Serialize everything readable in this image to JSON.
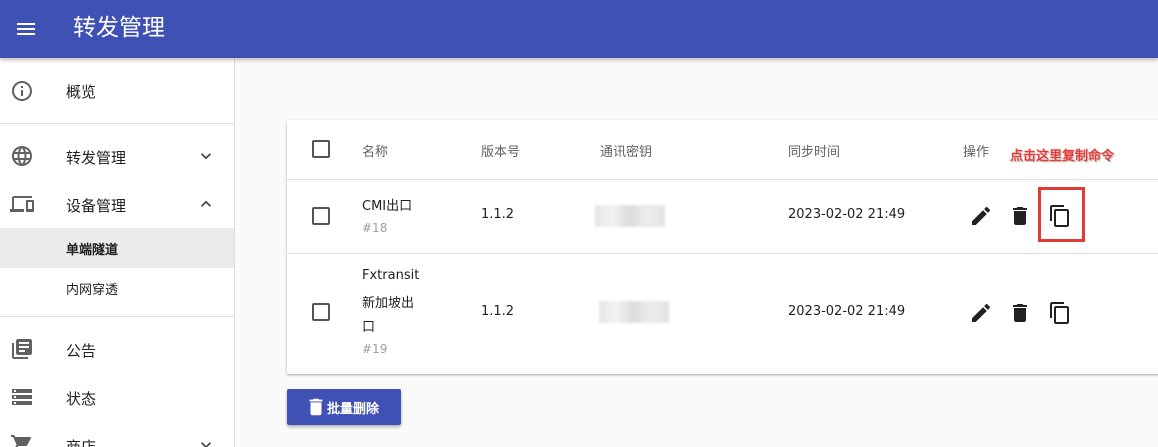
{
  "appbar": {
    "title": "转发管理",
    "menu_icon": "menu-icon",
    "color": "#3f51b5"
  },
  "sidebar": {
    "items": [
      {
        "label": "概览",
        "icon": "info-icon"
      },
      {
        "label": "转发管理",
        "icon": "globe-icon",
        "expanded": false
      },
      {
        "label": "设备管理",
        "icon": "devices-icon",
        "expanded": true,
        "children": [
          {
            "label": "单端隧道",
            "active": true
          },
          {
            "label": "内网穿透",
            "active": false
          }
        ]
      },
      {
        "label": "公告",
        "icon": "library-books-icon"
      },
      {
        "label": "状态",
        "icon": "storage-icon"
      },
      {
        "label": "商店",
        "icon": "cart-icon",
        "expanded": false
      }
    ]
  },
  "table": {
    "headers": [
      "名称",
      "版本号",
      "通讯密钥",
      "同步时间",
      "操作"
    ],
    "rows": [
      {
        "name": "CMI出口",
        "id": "#18",
        "version": "1.1.2",
        "key_hidden": true,
        "sync_time": "2023-02-02 21:49"
      },
      {
        "name_lines": [
          "Fxtransit",
          "新加坡出",
          "口"
        ],
        "id": "#19",
        "version": "1.1.2",
        "key_hidden": true,
        "sync_time": "2023-02-02 21:49"
      }
    ],
    "row_actions": [
      "edit-icon",
      "delete-icon",
      "copy-icon"
    ]
  },
  "annotation": {
    "text": "点击这里复制命令",
    "color": "#e53935"
  },
  "batch_delete": {
    "label": "批量删除",
    "icon": "delete-icon"
  }
}
